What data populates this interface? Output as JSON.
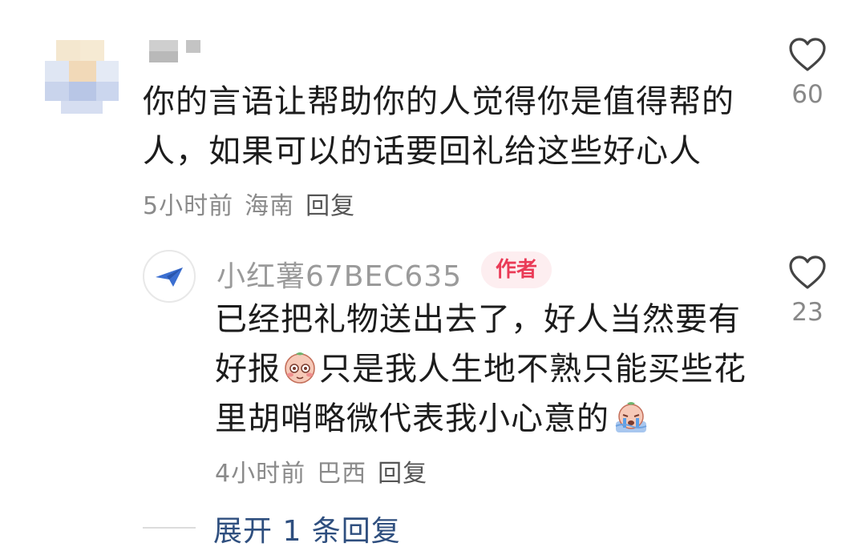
{
  "comment1": {
    "text_line1": "你的言语让帮助你的人觉得你是值得帮的",
    "text_line2": "人，如果可以的话要回礼给这些好心人",
    "time": "5小时前",
    "location": "海南",
    "reply_label": "回复",
    "likes": "60"
  },
  "reply1": {
    "username": "小红薯67BEC635",
    "badge": "作者",
    "line1": "已经把礼物送出去了，好人当然要有",
    "line2_a": "好报",
    "line2_b": "只是我人生地不熟只能买些花",
    "line3": "里胡哨略微代表我小心意的",
    "time": "4小时前",
    "location": "巴西",
    "reply_label": "回复",
    "likes": "23"
  },
  "expand_label": "展开 1 条回复",
  "icons": {
    "like": "heart-outline-icon",
    "avatar2": "paper-plane-icon",
    "emoji1": "blushing-face-emoji",
    "emoji2": "crying-face-emoji"
  },
  "colors": {
    "badge_text": "#ea3b57",
    "badge_bg": "#fdeef0",
    "expand_text": "#2f4f7f",
    "plane": "#3b6fd1"
  }
}
